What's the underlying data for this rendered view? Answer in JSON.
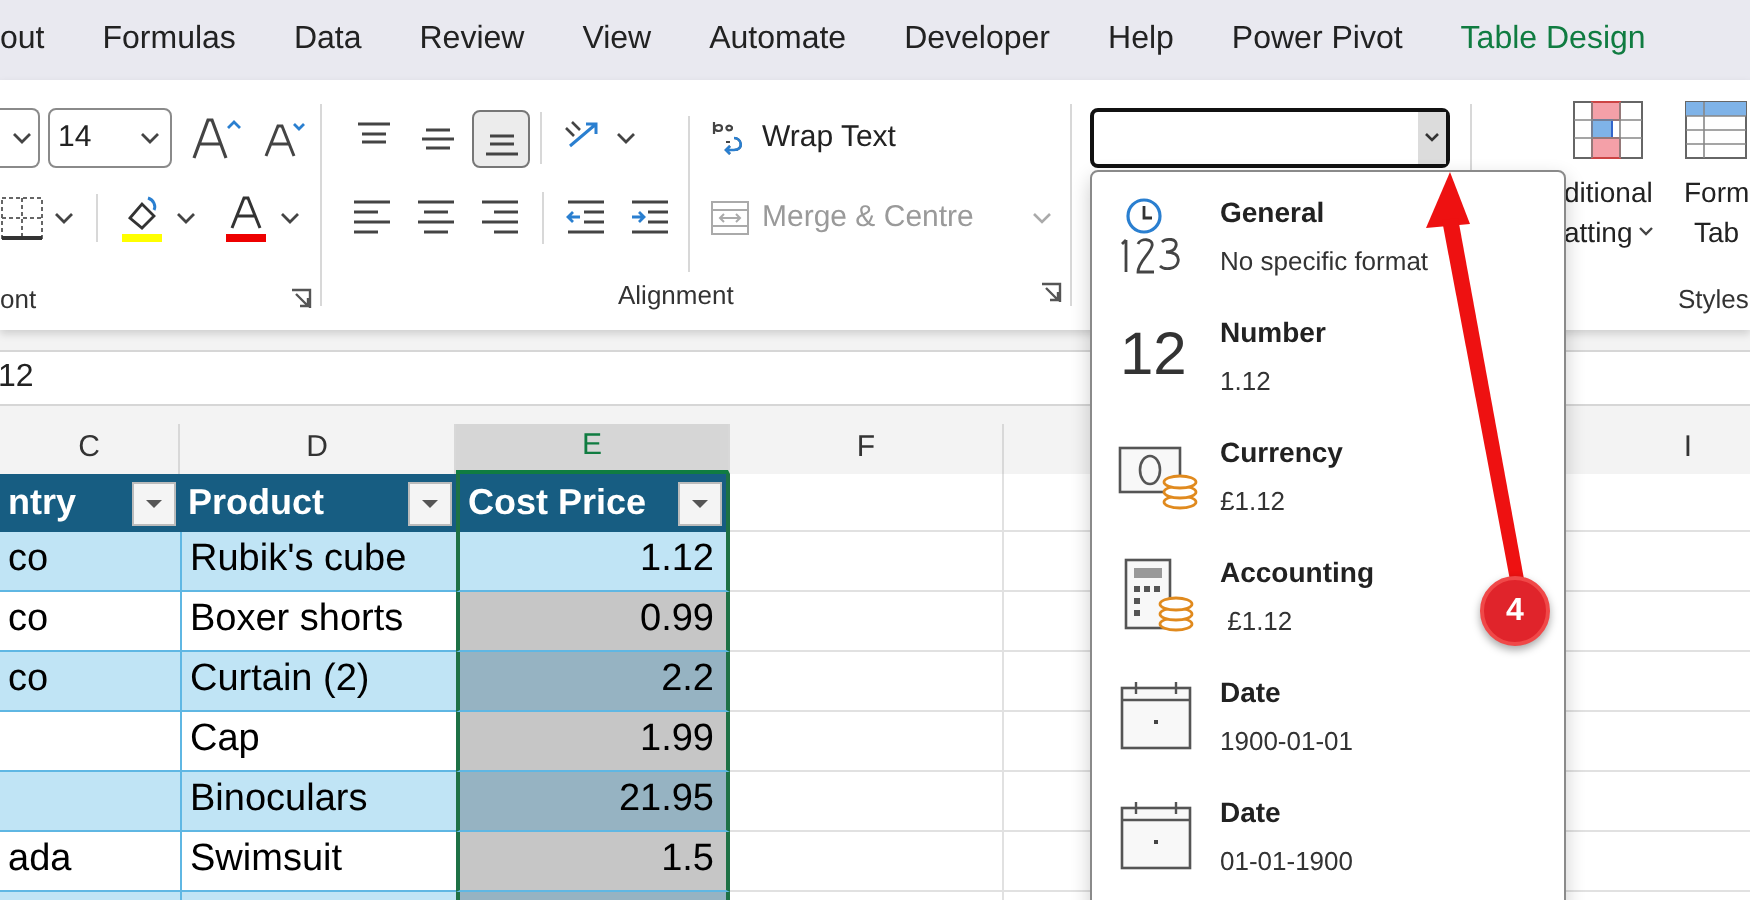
{
  "ribbon_tabs": [
    {
      "label": "out",
      "selected": false
    },
    {
      "label": "Formulas",
      "selected": false
    },
    {
      "label": "Data",
      "selected": false
    },
    {
      "label": "Review",
      "selected": false
    },
    {
      "label": "View",
      "selected": false
    },
    {
      "label": "Automate",
      "selected": false
    },
    {
      "label": "Developer",
      "selected": false
    },
    {
      "label": "Help",
      "selected": false
    },
    {
      "label": "Power Pivot",
      "selected": false
    },
    {
      "label": "Table Design",
      "selected": true
    }
  ],
  "font_group": {
    "size": "14",
    "label": "ont"
  },
  "alignment_group": {
    "label": "Alignment",
    "vertical_align": [
      {
        "kind": "top",
        "selected": false
      },
      {
        "kind": "middle",
        "selected": false
      },
      {
        "kind": "bottom",
        "selected": true
      }
    ],
    "wrap_text": "Wrap Text",
    "merge": {
      "label": "Merge & Centre",
      "disabled": true
    }
  },
  "number_format_menu": [
    {
      "kind": "general",
      "title": "General",
      "example": "No specific format"
    },
    {
      "kind": "number",
      "title": "Number",
      "example": "1.12",
      "icon_text": "12"
    },
    {
      "kind": "currency",
      "title": "Currency",
      "example": "£1.12"
    },
    {
      "kind": "accounting",
      "title": "Accounting",
      "example": " £1.12"
    },
    {
      "kind": "date",
      "title": "Date",
      "example": "1900-01-01"
    },
    {
      "kind": "date",
      "title": "Date",
      "example": "01-01-1900"
    }
  ],
  "styles_group": {
    "conditional_formatting": [
      "ditional",
      "atting"
    ],
    "format_as_table": [
      "Form",
      "Tab"
    ],
    "label": "Styles"
  },
  "formula_bar": {
    "value": "12"
  },
  "column_headers": [
    {
      "letter": "C",
      "selected": false
    },
    {
      "letter": "D",
      "selected": false
    },
    {
      "letter": "E",
      "selected": true
    },
    {
      "letter": "F",
      "selected": false
    },
    {
      "letter": "I",
      "selected": false
    }
  ],
  "table": {
    "columns": [
      "ntry",
      "Product",
      "Cost Price"
    ],
    "rows": [
      {
        "country": "co",
        "product": "Rubik's cube",
        "cost_price": "1.12",
        "selected": false
      },
      {
        "country": "co",
        "product": "Boxer shorts",
        "cost_price": "0.99",
        "selected": true
      },
      {
        "country": "co",
        "product": "Curtain (2)",
        "cost_price": "2.2",
        "selected": true
      },
      {
        "product": "Cap",
        "cost_price": "1.99",
        "selected": true
      },
      {
        "product": "Binoculars",
        "cost_price": "21.95",
        "selected": true
      },
      {
        "country": "ada",
        "product": "Swimsuit",
        "cost_price": "1.5",
        "selected": true
      }
    ]
  },
  "callout": {
    "number": "4"
  }
}
